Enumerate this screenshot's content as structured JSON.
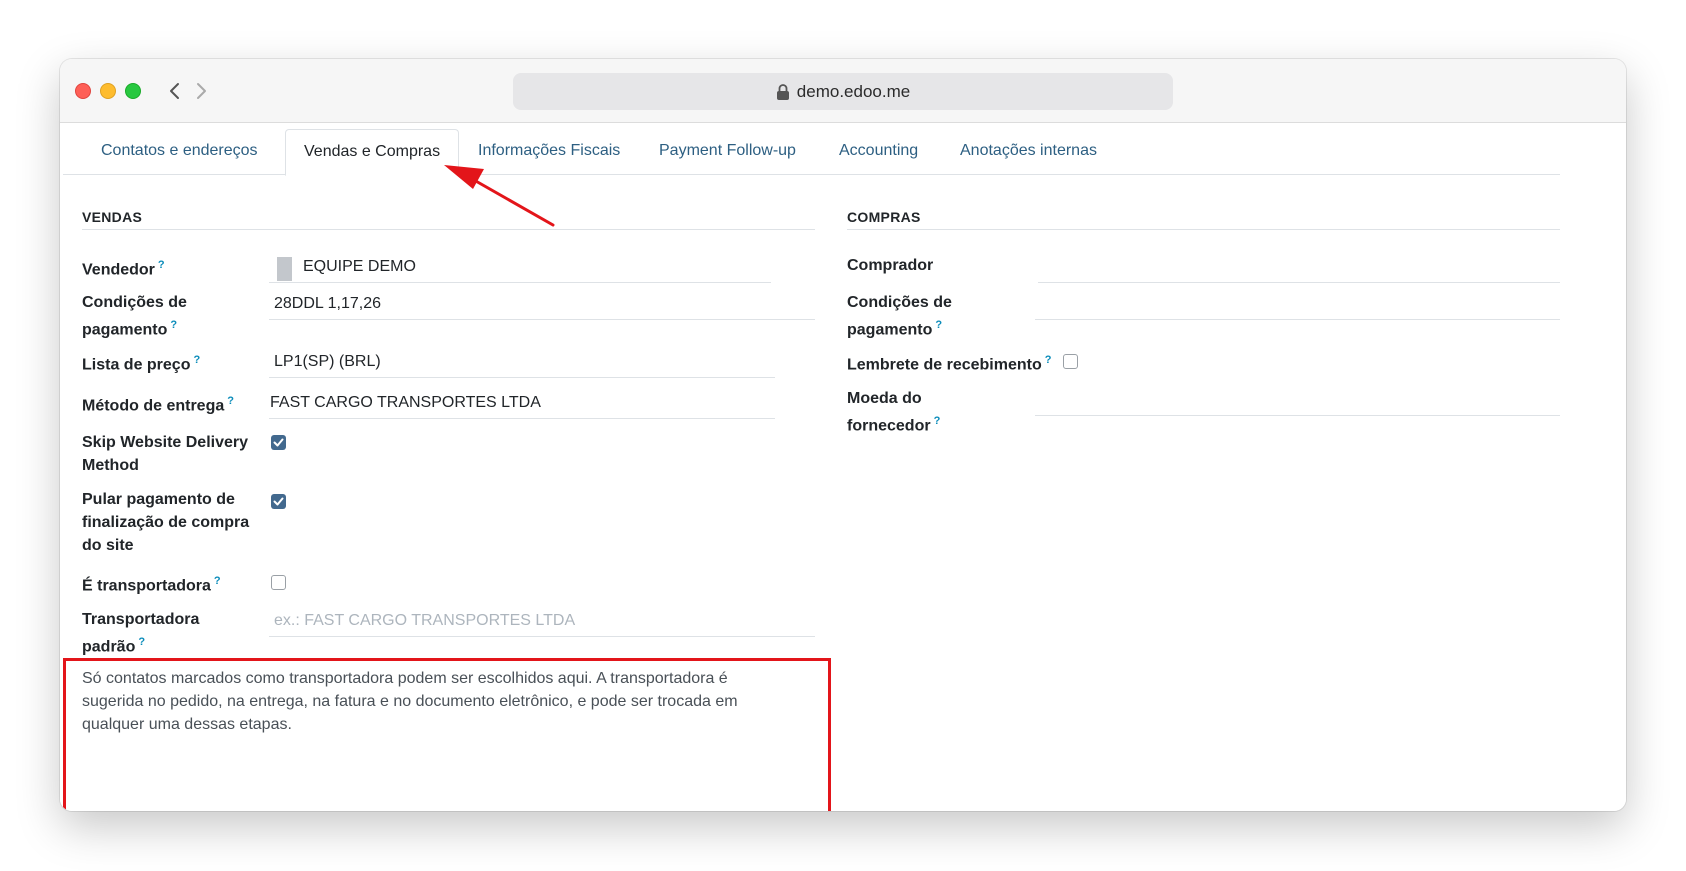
{
  "browser": {
    "url": "demo.edoo.me"
  },
  "tabs": [
    {
      "label": "Contatos e endereços",
      "active": false
    },
    {
      "label": "Vendas e Compras",
      "active": true
    },
    {
      "label": "Informações Fiscais",
      "active": false
    },
    {
      "label": "Payment Follow-up",
      "active": false
    },
    {
      "label": "Accounting",
      "active": false
    },
    {
      "label": "Anotações internas",
      "active": false
    }
  ],
  "vendas": {
    "title": "VENDAS",
    "vendedor": {
      "label": "Vendedor",
      "help": "?",
      "value": "EQUIPE DEMO"
    },
    "condicoes": {
      "label_line1": "Condições de",
      "label_line2": "pagamento",
      "help": "?",
      "value": "28DDL 1,17,26"
    },
    "lista_preco": {
      "label": "Lista de preço",
      "help": "?",
      "value": "LP1(SP) (BRL)"
    },
    "metodo_entrega": {
      "label": "Método de entrega",
      "help": "?",
      "value": "FAST CARGO TRANSPORTES LTDA"
    },
    "skip_delivery": {
      "label_line1": "Skip Website Delivery",
      "label_line2": "Method",
      "checked": true
    },
    "pular_pagamento": {
      "label_line1": "Pular pagamento de",
      "label_line2": "finalização de compra",
      "label_line3": "do site",
      "checked": true
    },
    "e_transportadora": {
      "label": "É transportadora",
      "help": "?",
      "checked": false
    },
    "transportadora_padrao": {
      "label_line1": "Transportadora",
      "label_line2": "padrão",
      "help": "?",
      "placeholder": "ex.: FAST CARGO TRANSPORTES LTDA"
    },
    "help_text_line1": "Só contatos marcados como transportadora podem ser escolhidos aqui. A transportadora é",
    "help_text_line2": "sugerida no pedido, na entrega, na fatura e no documento eletrônico, e pode ser trocada em",
    "help_text_line3": "qualquer uma dessas etapas."
  },
  "compras": {
    "title": "COMPRAS",
    "comprador": {
      "label": "Comprador",
      "value": ""
    },
    "condicoes": {
      "label_line1": "Condições de",
      "label_line2": "pagamento",
      "help": "?",
      "value": ""
    },
    "lembrete": {
      "label": "Lembrete de recebimento",
      "help": "?",
      "checked": false
    },
    "moeda": {
      "label_line1": "Moeda do",
      "label_line2": "fornecedor",
      "help": "?",
      "value": ""
    }
  },
  "colors": {
    "link": "#2d5f82",
    "help": "#0b8cba",
    "checkbox": "#42698e",
    "highlight": "#e3151a",
    "annotation_arrow": "#e3151a"
  }
}
